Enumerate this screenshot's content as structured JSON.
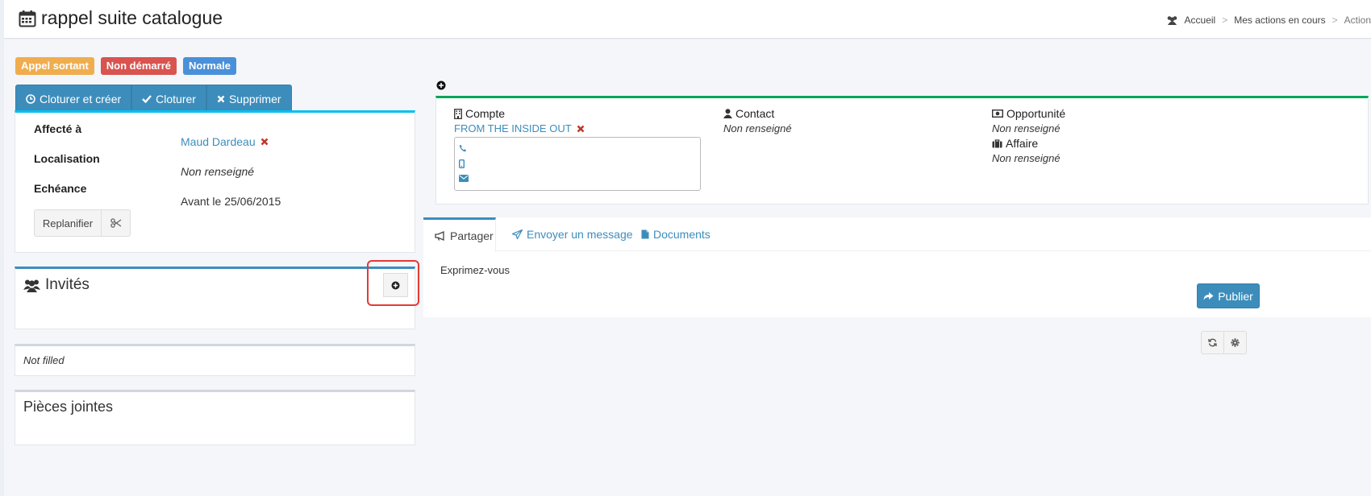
{
  "header": {
    "title": "rappel suite catalogue",
    "breadcrumb": [
      "Accueil",
      "Mes actions en cours",
      "Action"
    ],
    "breadcrumb_separator": ">"
  },
  "badges": [
    {
      "label": "Appel sortant",
      "color": "#f0ad4e"
    },
    {
      "label": "Non démarré",
      "color": "#d9534f"
    },
    {
      "label": "Normale",
      "color": "#4a90d9"
    }
  ],
  "actions": {
    "close_create": "Cloturer et créer",
    "close": "Cloturer",
    "delete": "Supprimer"
  },
  "details": {
    "assigned_label": "Affecté à",
    "assigned_value": "Maud Dardeau",
    "location_label": "Localisation",
    "location_value": "Non renseigné",
    "due_label": "Echéance",
    "due_value": "Avant le 25/06/2015",
    "reschedule": "Replanifier"
  },
  "invites": {
    "title": "Invités"
  },
  "note": {
    "text": "Not filled"
  },
  "attachments": {
    "title": "Pièces jointes"
  },
  "relations": {
    "account_label": "Compte",
    "account_value": "FROM THE INSIDE OUT",
    "contact_label": "Contact",
    "contact_value": "Non renseigné",
    "opportunity_label": "Opportunité",
    "opportunity_value": "Non renseigné",
    "deal_label": "Affaire",
    "deal_value": "Non renseigné"
  },
  "tabs": [
    {
      "label": "Partager"
    },
    {
      "label": "Envoyer un message"
    },
    {
      "label": "Documents"
    }
  ],
  "share": {
    "placeholder": "Exprimez-vous",
    "publish": "Publier"
  },
  "colors": {
    "primary": "#3c8dbc",
    "success": "#00a65a",
    "info": "#00c0ef",
    "highlight": "#e53935"
  }
}
